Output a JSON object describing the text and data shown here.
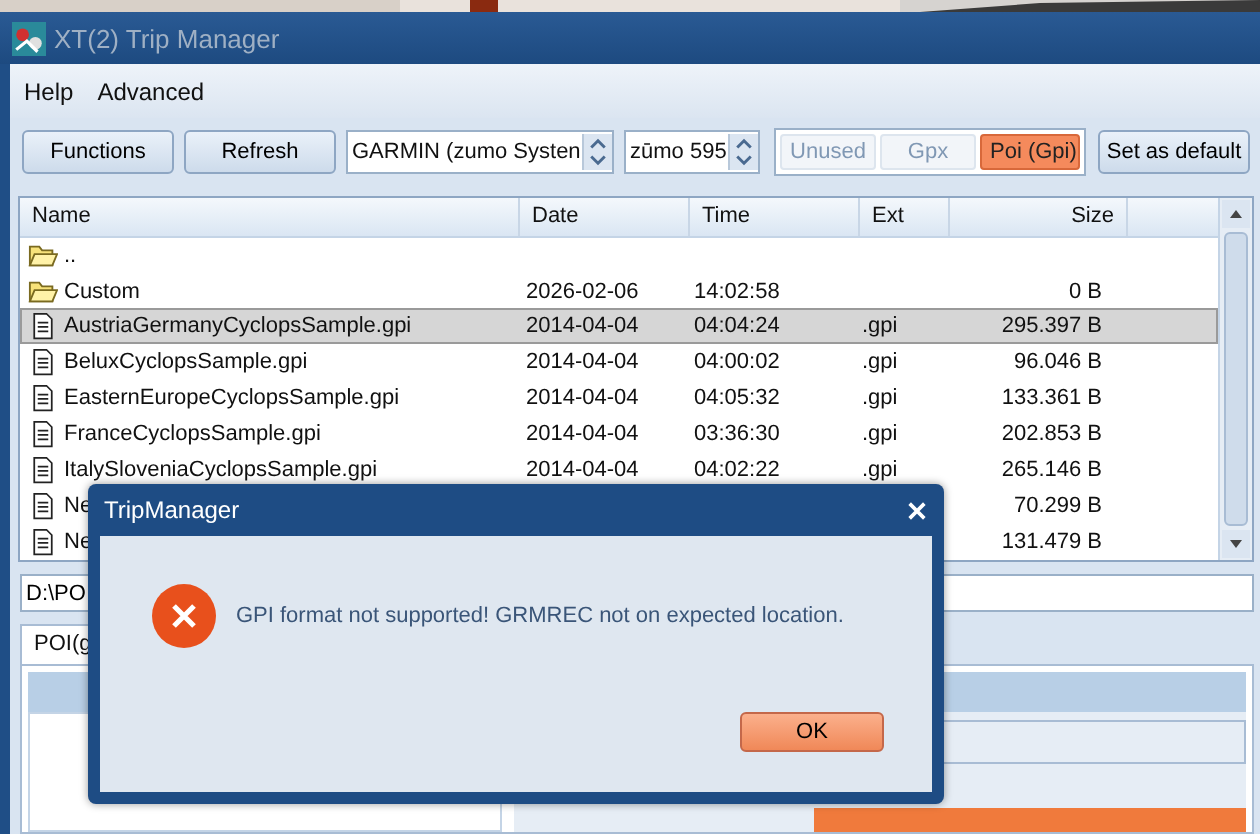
{
  "window": {
    "title": "XT(2) Trip Manager"
  },
  "menu": [
    "Help",
    "Advanced"
  ],
  "toolbar": {
    "buttons": [
      "Functions",
      "Refresh"
    ],
    "device_select": {
      "value": "GARMIN (zumo Systen"
    },
    "model_select": {
      "value": "zūmo 595"
    },
    "modes": [
      {
        "label": "Unused",
        "selected": false
      },
      {
        "label": "Gpx",
        "selected": false
      },
      {
        "label": "Poi (Gpi)",
        "selected": true
      }
    ],
    "default_button": "Set as default"
  },
  "table": {
    "columns": [
      "Name",
      "Date",
      "Time",
      "Ext",
      "Size"
    ],
    "rows": [
      {
        "kind": "folder",
        "name": "..",
        "date": "",
        "time": "",
        "ext": "",
        "size": "",
        "selected": false
      },
      {
        "kind": "folder",
        "name": "Custom",
        "date": "2026-02-06",
        "time": "14:02:58",
        "ext": "",
        "size": "0 B",
        "selected": false
      },
      {
        "kind": "file",
        "name": "AustriaGermanyCyclopsSample.gpi",
        "date": "2014-04-04",
        "time": "04:04:24",
        "ext": ".gpi",
        "size": "295.397 B",
        "selected": true
      },
      {
        "kind": "file",
        "name": "BeluxCyclopsSample.gpi",
        "date": "2014-04-04",
        "time": "04:00:02",
        "ext": ".gpi",
        "size": "96.046 B",
        "selected": false
      },
      {
        "kind": "file",
        "name": "EasternEuropeCyclopsSample.gpi",
        "date": "2014-04-04",
        "time": "04:05:32",
        "ext": ".gpi",
        "size": "133.361 B",
        "selected": false
      },
      {
        "kind": "file",
        "name": "FranceCyclopsSample.gpi",
        "date": "2014-04-04",
        "time": "03:36:30",
        "ext": ".gpi",
        "size": "202.853 B",
        "selected": false
      },
      {
        "kind": "file",
        "name": "ItalySloveniaCyclopsSample.gpi",
        "date": "2014-04-04",
        "time": "04:02:22",
        "ext": ".gpi",
        "size": "265.146 B",
        "selected": false
      },
      {
        "kind": "file",
        "name": "Ne",
        "date": "",
        "time": "",
        "ext": "",
        "size": "70.299 B",
        "selected": false
      },
      {
        "kind": "file",
        "name": "Ne",
        "date": "",
        "time": "",
        "ext": "",
        "size": "131.479 B",
        "selected": false
      }
    ]
  },
  "path_field": {
    "value": "D:\\PO"
  },
  "bottom_tabs": [
    {
      "label": "POI(g",
      "selected": true
    }
  ],
  "dialog": {
    "title": "TripManager",
    "message": "GPI format not supported! GRMREC not on expected location.",
    "button": "OK"
  }
}
